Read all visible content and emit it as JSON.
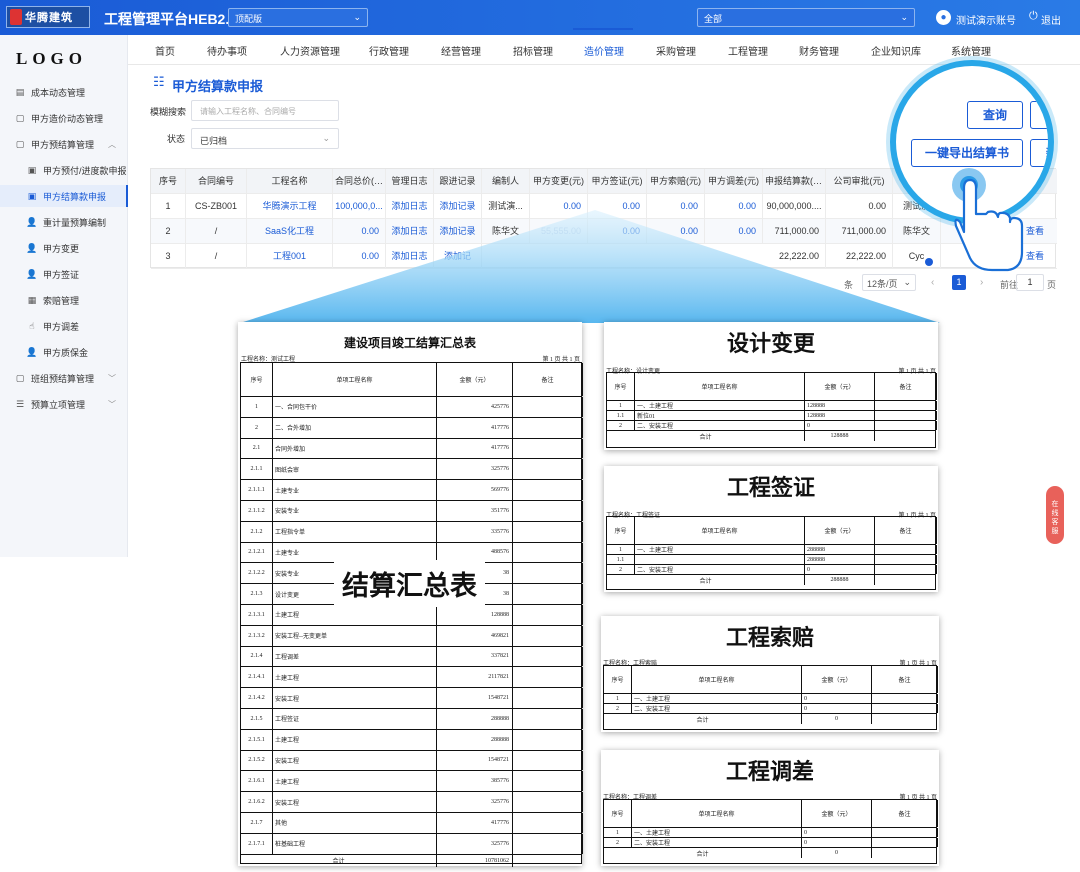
{
  "header": {
    "logo_text": "华腾建筑",
    "app_title": "工程管理平台HEB2.0",
    "version_select": "顶配版",
    "org_select": "全部",
    "user_name": "测试演示账号",
    "logout": "退出"
  },
  "sidebar": {
    "logo": "LOGO",
    "items": [
      {
        "label": "成本动态管理",
        "icon": "chart-icon"
      },
      {
        "label": "甲方造价动态管理",
        "icon": "document-icon"
      },
      {
        "label": "甲方预结算管理",
        "icon": "document-icon"
      },
      {
        "label": "甲方预付/进度款申报",
        "icon": "file-icon"
      },
      {
        "label": "甲方结算款申报",
        "icon": "file-icon"
      },
      {
        "label": "重计量预算编制",
        "icon": "user-icon"
      },
      {
        "label": "甲方变更",
        "icon": "user-icon"
      },
      {
        "label": "甲方签证",
        "icon": "user-icon"
      },
      {
        "label": "索赔管理",
        "icon": "briefcase-icon"
      },
      {
        "label": "甲方调差",
        "icon": "hand-icon"
      },
      {
        "label": "甲方质保金",
        "icon": "user-icon"
      },
      {
        "label": "班组预结算管理",
        "icon": "document-icon"
      },
      {
        "label": "预算立项管理",
        "icon": "list-icon"
      }
    ]
  },
  "nav": {
    "tabs": [
      "首页",
      "待办事项",
      "人力资源管理",
      "行政管理",
      "经营管理",
      "招标管理",
      "造价管理",
      "采购管理",
      "工程管理",
      "财务管理",
      "企业知识库",
      "系统管理"
    ]
  },
  "page": {
    "title": "甲方结算款申报",
    "search_label": "模糊搜索",
    "search_placeholder": "请输入工程名称、合同编号",
    "status_label": "状态",
    "status_value": "已归档"
  },
  "table": {
    "headers": [
      "序号",
      "合同编号",
      "工程名称",
      "合同总价(元)",
      "管理日志",
      "跟进记录",
      "编制人",
      "甲方变更(元)",
      "甲方签证(元)",
      "甲方索赔(元)",
      "甲方调差(元)",
      "申报结算款(元)",
      "公司审批(元)"
    ],
    "rows": [
      [
        "1",
        "CS-ZB001",
        "华腾演示工程",
        "100,000,0...",
        "添加日志",
        "添加记录",
        "测试演...",
        "0.00",
        "0.00",
        "0.00",
        "0.00",
        "90,000,000....",
        "0.00"
      ],
      [
        "2",
        "/",
        "SaaS化工程",
        "0.00",
        "添加日志",
        "添加记录",
        "陈华文",
        "55,555.00",
        "0.00",
        "0.00",
        "0.00",
        "711,000.00",
        "711,000.00"
      ],
      [
        "3",
        "/",
        "工程001",
        "0.00",
        "添加日志",
        "添加记",
        "",
        "",
        "",
        "",
        "",
        "22,222.00",
        "22,222.00"
      ]
    ],
    "extra_col": [
      "测试演",
      "陈华文",
      "Cyc"
    ],
    "view_label": "查看"
  },
  "pagination": {
    "total_suffix": "条",
    "page_size": "12条/页",
    "current": "1",
    "goto_label": "前往",
    "goto_value": "1",
    "page_unit": "页"
  },
  "magnifier": {
    "query": "查询",
    "export": "一键导出结算书",
    "edge_label": "新"
  },
  "chat": {
    "label": "在线客服"
  },
  "summary_doc": {
    "title": "建设项目竣工结算汇总表",
    "project": "工程名称：测试工程",
    "page": "第 1 页 共 1 页",
    "headers": [
      "序号",
      "单项工程名称",
      "金额（元）",
      "备注"
    ],
    "rows": [
      [
        "1",
        "一、合同包干价",
        "425776"
      ],
      [
        "2",
        "二、合外增加",
        "417776"
      ],
      [
        "2.1",
        "合同外增加",
        "417776"
      ],
      [
        "2.1.1",
        "图纸会审",
        "325776"
      ],
      [
        "2.1.1.1",
        "土建专业",
        "569776"
      ],
      [
        "2.1.1.2",
        "安装专业",
        "351776"
      ],
      [
        "2.1.2",
        "工程指令单",
        "335776"
      ],
      [
        "2.1.2.1",
        "土建专业",
        "488576"
      ],
      [
        "2.1.2.2",
        "安装专业",
        "38"
      ],
      [
        "2.1.3",
        "设计变更",
        "38"
      ],
      [
        "2.1.3.1",
        "土建工程",
        "128888"
      ],
      [
        "2.1.3.2",
        "安装工程--无变更单",
        "469821"
      ],
      [
        "2.1.4",
        "工程调差",
        "337821"
      ],
      [
        "2.1.4.1",
        "土建工程",
        "2117821"
      ],
      [
        "2.1.4.2",
        "安装工程",
        "1548721"
      ],
      [
        "2.1.5",
        "工程签证",
        "288888"
      ],
      [
        "2.1.5.1",
        "土建工程",
        "288888"
      ],
      [
        "2.1.5.2",
        "安装工程",
        "1548721"
      ],
      [
        "2.1.6.1",
        "土建工程",
        "385776"
      ],
      [
        "2.1.6.2",
        "安装工程",
        "325776"
      ],
      [
        "2.1.7",
        "其他",
        "417776"
      ],
      [
        "2.1.7.1",
        "桩基础工程",
        "325776"
      ]
    ],
    "total_label": "合计",
    "total_value": "10781062",
    "overlay_label": "结算汇总表"
  },
  "side_docs": [
    {
      "title": "设计变更",
      "project": "工程名称：设计变更",
      "page": "第 1 页 共 1 页",
      "rows": [
        [
          "1",
          "一、土建工程",
          "128888"
        ],
        [
          "1.1",
          "新位01",
          "128888"
        ],
        [
          "2",
          "二、安装工程",
          "0"
        ]
      ],
      "total": "128888"
    },
    {
      "title": "工程签证",
      "project": "工程名称：工程签证",
      "page": "第 1 页 共 1 页",
      "rows": [
        [
          "1",
          "一、土建工程",
          "288888"
        ],
        [
          "1.1",
          "",
          "288888"
        ],
        [
          "2",
          "二、安装工程",
          "0"
        ]
      ],
      "total": "288888"
    },
    {
      "title": "工程索赔",
      "project": "工程名称：工程索赔",
      "page": "第 1 页 共 1 页",
      "rows": [
        [
          "1",
          "一、土建工程",
          "0"
        ],
        [
          "2",
          "二、安装工程",
          "0"
        ]
      ],
      "total": "0"
    },
    {
      "title": "工程调差",
      "project": "工程名称：工程调差",
      "page": "第 1 页 共 1 页",
      "rows": [
        [
          "1",
          "一、土建工程",
          "0"
        ],
        [
          "2",
          "二、安装工程",
          "0"
        ]
      ],
      "total": "0"
    }
  ],
  "side_doc_headers": [
    "序号",
    "单项工程名称",
    "金额（元）",
    "备注"
  ],
  "side_doc_total_label": "合计"
}
